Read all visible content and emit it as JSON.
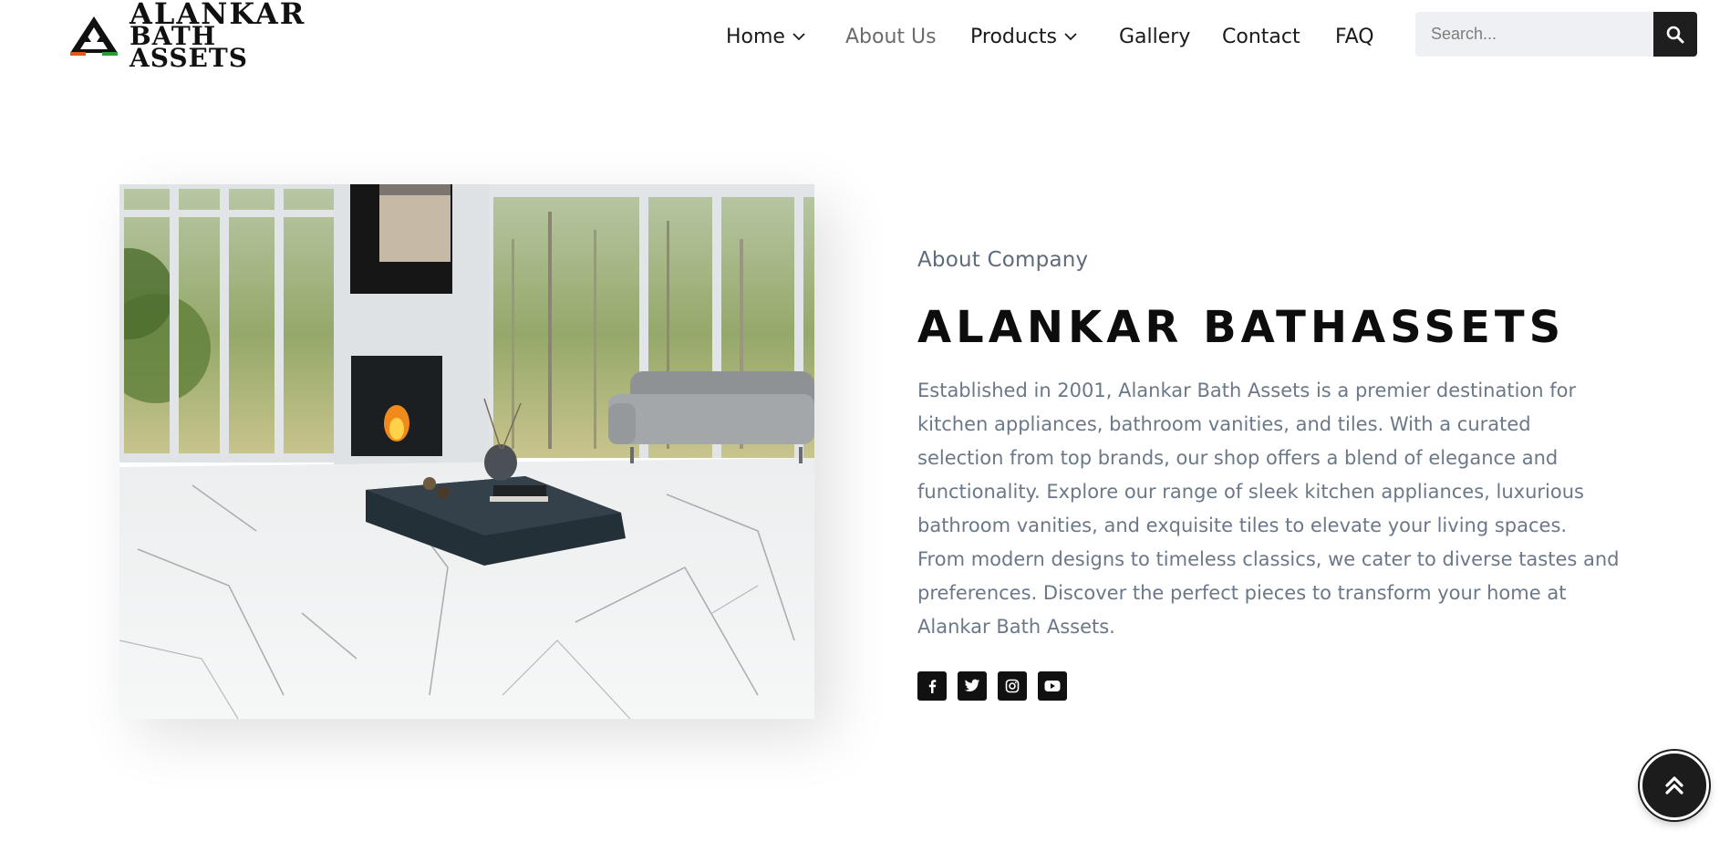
{
  "brand": {
    "line1": "ALANKAR",
    "line2": "BATH ASSETS"
  },
  "nav": {
    "items": [
      {
        "label": "Home",
        "has_dropdown": true
      },
      {
        "label": "About Us",
        "active": true
      },
      {
        "label": "Products",
        "has_dropdown": true
      },
      {
        "label": "Gallery"
      },
      {
        "label": "Contact"
      },
      {
        "label": "FAQ"
      }
    ]
  },
  "search": {
    "placeholder": "Search...",
    "button_icon": "search-icon"
  },
  "hero": {
    "image_alt": "Living room with marble floor, fireplace, grey sofa and dark coffee table",
    "icon": "photo"
  },
  "about": {
    "eyebrow": "About Company",
    "title": "ALANKAR BATHASSETS",
    "description": "Established in 2001, Alankar Bath Assets is a premier destination for kitchen appliances, bathroom vanities, and tiles. With a curated selection from top brands, our shop offers a blend of elegance and functionality. Explore our range of sleek kitchen appliances, luxurious bathroom vanities, and exquisite tiles to elevate your living spaces. From modern designs to timeless classics, we cater to diverse tastes and preferences. Discover the perfect pieces to transform your home at Alankar Bath Assets.",
    "social": [
      "facebook-icon",
      "twitter-icon",
      "instagram-icon",
      "youtube-icon"
    ]
  },
  "back_to_top": {
    "icon": "double-chevron-up-icon"
  },
  "colors": {
    "text_dark": "#1a1a1a",
    "text_muted": "#6b7888",
    "nav_active": "#6b6b6b",
    "search_bg": "#eef0f3",
    "button_dark": "#1e1e1e",
    "logo_orange": "#e8571a",
    "logo_green": "#2e9a3f"
  }
}
